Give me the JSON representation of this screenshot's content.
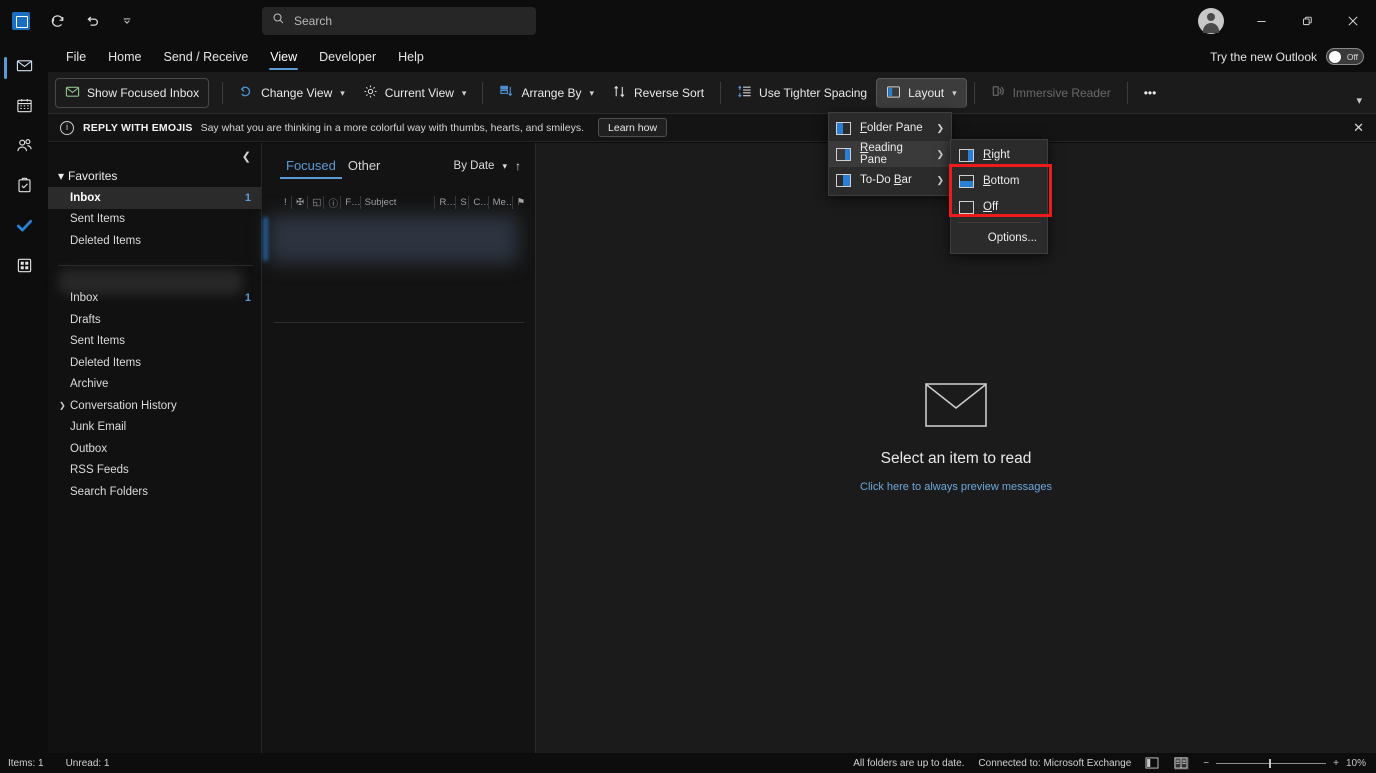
{
  "titlebar": {
    "logo_icon": "outlook-logo-icon",
    "quick_access": [
      {
        "icon": "send-receive-sync-icon",
        "glyph": "⟳"
      },
      {
        "icon": "undo-icon",
        "glyph": "↶"
      },
      {
        "icon": "customize-qat-chevron-icon",
        "glyph": "⌄"
      }
    ],
    "search": {
      "icon": "search-icon",
      "placeholder": "Search",
      "value": "Search"
    },
    "account_icon": "account-avatar-icon",
    "window_buttons": [
      {
        "name": "minimize-button",
        "glyph": "─"
      },
      {
        "name": "restore-button",
        "glyph": "❐"
      },
      {
        "name": "close-button",
        "glyph": "✕"
      }
    ]
  },
  "tabs": [
    {
      "label": "File",
      "active": false
    },
    {
      "label": "Home",
      "active": false
    },
    {
      "label": "Send / Receive",
      "active": false
    },
    {
      "label": "View",
      "active": true
    },
    {
      "label": "Developer",
      "active": false
    },
    {
      "label": "Help",
      "active": false
    }
  ],
  "new_outlook": {
    "label": "Try the new Outlook",
    "toggle_state": "Off"
  },
  "ribbon": {
    "items": [
      {
        "label": "Show Focused Inbox",
        "icon": "focused-inbox-icon",
        "style": "boxed",
        "caret": false
      },
      {
        "label": "Change View",
        "icon": "change-view-icon",
        "style": "plain",
        "caret": true
      },
      {
        "label": "Current View",
        "icon": "gear-icon",
        "style": "plain",
        "caret": true
      },
      {
        "label": "Arrange By",
        "icon": "arrange-by-icon",
        "style": "plain",
        "caret": true
      },
      {
        "label": "Reverse Sort",
        "icon": "reverse-sort-icon",
        "style": "plain",
        "caret": false
      },
      {
        "label": "Use Tighter Spacing",
        "icon": "tighter-spacing-icon",
        "style": "plain",
        "caret": false
      },
      {
        "label": "Layout",
        "icon": "layout-icon",
        "style": "active",
        "caret": true
      },
      {
        "label": "Immersive Reader",
        "icon": "immersive-reader-icon",
        "style": "disabled",
        "caret": false
      },
      {
        "label": "•••",
        "icon": "more-commands-icon",
        "style": "plain",
        "caret": false
      }
    ],
    "expand_icon": "ribbon-expand-chevron-icon"
  },
  "banner": {
    "info_icon": "info-icon",
    "title": "REPLY WITH EMOJIS",
    "text": "Say what you are thinking in a more colorful way with thumbs, hearts, and smileys.",
    "button": "Learn how",
    "close_icon": "close-icon"
  },
  "rail": [
    {
      "name": "mail",
      "icon": "mail-icon",
      "selected": true
    },
    {
      "name": "calendar",
      "icon": "calendar-icon",
      "selected": false
    },
    {
      "name": "people",
      "icon": "people-icon",
      "selected": false
    },
    {
      "name": "tasks",
      "icon": "tasks-clipboard-icon",
      "selected": false
    },
    {
      "name": "todo",
      "icon": "checkmark-icon",
      "selected": false
    },
    {
      "name": "more-apps",
      "icon": "apps-grid-icon",
      "selected": false
    }
  ],
  "folder_pane": {
    "collapse_icon": "collapse-chevron-left-icon",
    "favorites_label": "Favorites",
    "favorites": [
      {
        "label": "Inbox",
        "count": "1",
        "selected": true
      },
      {
        "label": "Sent Items",
        "count": "",
        "selected": false
      },
      {
        "label": "Deleted Items",
        "count": "",
        "selected": false
      }
    ],
    "account_name": "",
    "folders": [
      {
        "label": "Inbox",
        "count": "1",
        "expandable": false
      },
      {
        "label": "Drafts",
        "count": "",
        "expandable": false
      },
      {
        "label": "Sent Items",
        "count": "",
        "expandable": false
      },
      {
        "label": "Deleted Items",
        "count": "",
        "expandable": false
      },
      {
        "label": "Archive",
        "count": "",
        "expandable": false
      },
      {
        "label": "Conversation History",
        "count": "",
        "expandable": true
      },
      {
        "label": "Junk Email",
        "count": "",
        "expandable": false
      },
      {
        "label": "Outbox",
        "count": "",
        "expandable": false
      },
      {
        "label": "RSS Feeds",
        "count": "",
        "expandable": false
      },
      {
        "label": "Search Folders",
        "count": "",
        "expandable": false
      }
    ]
  },
  "message_list": {
    "tabs": [
      {
        "label": "Focused",
        "active": true
      },
      {
        "label": "Other",
        "active": false
      }
    ],
    "sort": {
      "label": "By Date",
      "caret_icon": "chevron-down-icon",
      "direction_icon": "sort-ascending-arrow-icon"
    },
    "columns": [
      "!",
      "✠",
      "◱",
      "ⓘ",
      "F…",
      "Subject",
      "R…",
      "S",
      "C…",
      "Me…",
      "⚑"
    ]
  },
  "reading_pane": {
    "icon": "envelope-icon",
    "title": "Select an item to read",
    "link": "Click here to always preview messages"
  },
  "layout_menu": {
    "items": [
      {
        "label": "Folder Pane",
        "accel": "F",
        "icon": "pane-left-icon",
        "highlighted": false
      },
      {
        "label": "Reading Pane",
        "accel": "R",
        "icon": "pane-right-icon",
        "highlighted": true
      },
      {
        "label": "To-Do Bar",
        "accel": "B",
        "icon": "pane-right-narrow-icon",
        "highlighted": false
      }
    ],
    "arrow_icon": "chevron-right-icon"
  },
  "reading_pane_submenu": {
    "items": [
      {
        "label": "Right",
        "accel": "R",
        "icon": "pane-right-icon",
        "highlighted": false
      },
      {
        "label": "Bottom",
        "accel": "B",
        "icon": "pane-bottom-icon",
        "highlighted": false
      },
      {
        "label": "Off",
        "accel": "O",
        "icon": "pane-off-icon",
        "highlighted": false
      }
    ],
    "options_label": "Options...",
    "highlight_color": "#ef1b1b"
  },
  "status_bar": {
    "items_label": "Items: 1",
    "unread_label": "Unread: 1",
    "sync_status": "All folders are up to date.",
    "connection": "Connected to: Microsoft Exchange",
    "view_normal_icon": "normal-view-icon",
    "view_reading_icon": "reading-view-icon",
    "zoom_out_icon": "zoom-out-icon",
    "zoom_in_icon": "zoom-in-icon",
    "zoom_level": "10%"
  }
}
